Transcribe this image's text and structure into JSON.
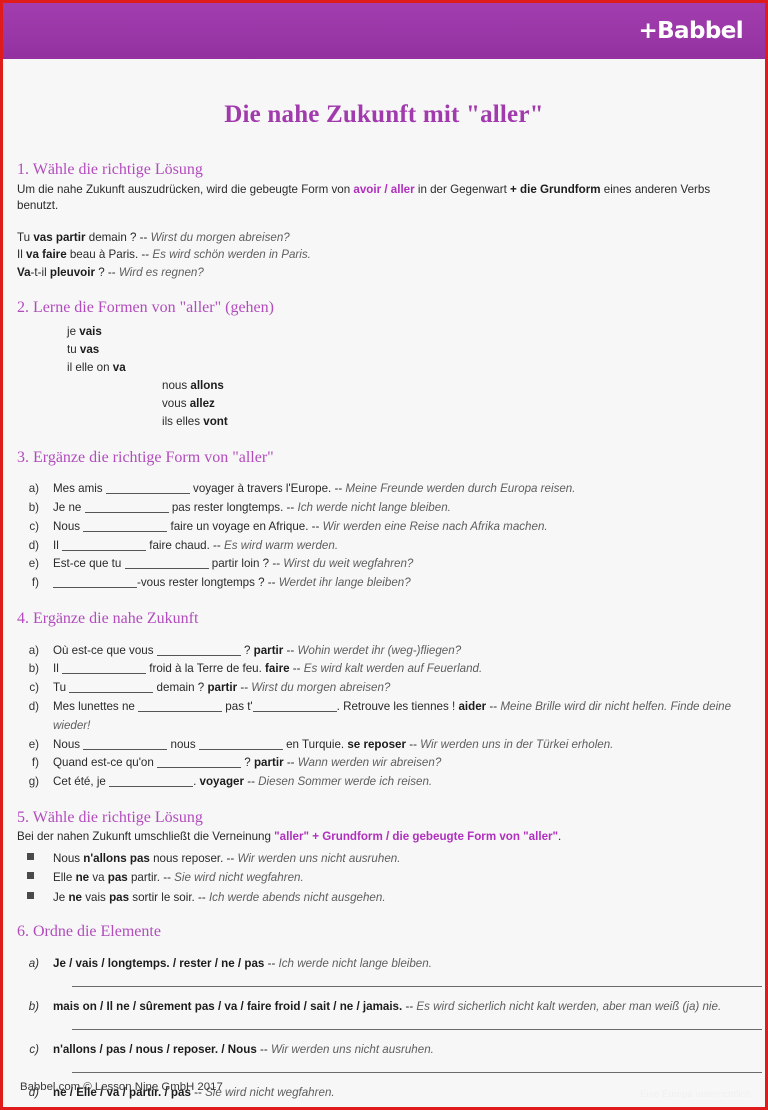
{
  "header": {
    "logo_text": "+Babbel",
    "bar_color": "#9a37a7"
  },
  "document": {
    "title": "Die nahe Zukunft mit \"aller\"",
    "title_color": "#a13aad",
    "accent_color": "#b12fbe"
  },
  "section1": {
    "heading": "1. Wähle die richtige Lösung",
    "intro_part1": "Um die nahe Zukunft auszudrücken, wird die gebeugte Form von ",
    "intro_option": "avoir / aller",
    "intro_part2": " in der Gegenwart ",
    "intro_bold": "+ die Grundform",
    "intro_part3": " eines anderen Verbs benutzt.",
    "examples": [
      {
        "fr_pre": "Tu ",
        "fr_bold": "vas partir",
        "fr_post": " demain ? -- ",
        "de": "Wirst du morgen abreisen?"
      },
      {
        "fr_pre": "Il ",
        "fr_bold": "va faire",
        "fr_post": " beau à Paris. -- ",
        "de": "Es wird schön werden in Paris."
      },
      {
        "fr_pre": "",
        "fr_bold": "Va",
        "fr_post": "-t-il ",
        "fr_bold2": "pleuvoir",
        "fr_post2": " ? -- ",
        "de": "Wird es regnen?"
      }
    ]
  },
  "section2": {
    "heading": "2. Lerne die Formen von \"aller\" (gehen)",
    "singular": [
      {
        "pronoun": "je ",
        "form": "vais"
      },
      {
        "pronoun": "tu ",
        "form": "vas"
      },
      {
        "pronoun": "il elle on ",
        "form": "va"
      }
    ],
    "plural": [
      {
        "pronoun": "nous ",
        "form": "allons"
      },
      {
        "pronoun": "vous ",
        "form": "allez"
      },
      {
        "pronoun": "ils elles ",
        "form": "vont"
      }
    ]
  },
  "section3": {
    "heading": "3. Ergänze die richtige Form von \"aller\"",
    "items": [
      {
        "letter": "a)",
        "pre": "Mes amis ",
        "post": " voyager à travers l'Europe. -- ",
        "de": "Meine Freunde werden durch Europa reisen."
      },
      {
        "letter": "b)",
        "pre": "Je ne ",
        "post": " pas rester longtemps. -- ",
        "de": "Ich werde nicht lange bleiben."
      },
      {
        "letter": "c)",
        "pre": "Nous ",
        "post": " faire un voyage en Afrique. -- ",
        "de": "Wir werden eine Reise nach Afrika machen."
      },
      {
        "letter": "d)",
        "pre": "Il ",
        "post": " faire chaud. -- ",
        "de": "Es wird warm werden."
      },
      {
        "letter": "e)",
        "pre": "Est-ce que tu ",
        "post": " partir loin ? -- ",
        "de": "Wirst du weit wegfahren?"
      },
      {
        "letter": "f)",
        "pre": "",
        "post": "-vous rester longtemps ? -- ",
        "de": "Werdet ihr lange bleiben?"
      }
    ]
  },
  "section4": {
    "heading": "4. Ergänze die nahe Zukunft",
    "items": [
      {
        "letter": "a)",
        "pre": "Où est-ce que vous ",
        "post": " ? ",
        "verb": "partir",
        "tail": " -- ",
        "de": "Wohin werdet ihr (weg-)fliegen?"
      },
      {
        "letter": "b)",
        "pre": "Il ",
        "post": " froid à la Terre de feu. ",
        "verb": "faire",
        "tail": " -- ",
        "de": "Es wird kalt werden auf Feuerland."
      },
      {
        "letter": "c)",
        "pre": "Tu ",
        "post": " demain ? ",
        "verb": "partir",
        "tail": " -- ",
        "de": "Wirst du morgen abreisen?"
      },
      {
        "letter": "d)",
        "pre": "Mes lunettes ne ",
        "mid": " pas t'",
        "post": ". Retrouve les tiennes ! ",
        "verb": "aider",
        "tail": " -- ",
        "de": "Meine Brille wird dir nicht helfen. Finde deine wieder!",
        "two_blanks": true
      },
      {
        "letter": "e)",
        "pre": "Nous ",
        "mid": " nous ",
        "post": " en Turquie. ",
        "verb": "se reposer",
        "tail": " -- ",
        "de": "Wir werden uns in der Türkei erholen.",
        "two_blanks": true
      },
      {
        "letter": "f)",
        "pre": "Quand est-ce qu'on ",
        "post": " ? ",
        "verb": "partir",
        "tail": " -- ",
        "de": "Wann werden wir abreisen?"
      },
      {
        "letter": "g)",
        "pre": "Cet été, je ",
        "post": ". ",
        "verb": "voyager",
        "tail": " -- ",
        "de": "Diesen Sommer werde ich reisen."
      }
    ]
  },
  "section5": {
    "heading": "5. Wähle die richtige Lösung",
    "intro_pre": "Bei der nahen Zukunft umschließt die Verneinung ",
    "intro_option": "\"aller\" + Grundform / die gebeugte Form von \"aller\"",
    "intro_post": ".",
    "items": [
      {
        "pre": "Nous ",
        "b1": "n'allons",
        "mid": " ",
        "b2": "pas",
        "post": " nous reposer. -- ",
        "de": "Wir werden uns nicht ausruhen."
      },
      {
        "pre": "Elle ",
        "b1": "ne",
        "mid": " va ",
        "b2": "pas",
        "post": " partir. -- ",
        "de": "Sie wird nicht wegfahren."
      },
      {
        "pre": "Je ",
        "b1": "ne",
        "mid": " vais ",
        "b2": "pas",
        "post": " sortir le soir. -- ",
        "de": "Ich werde abends nicht ausgehen."
      }
    ]
  },
  "section6": {
    "heading": "6. Ordne die Elemente",
    "items": [
      {
        "letter": "a)",
        "elements": "Je / vais / longtemps. / rester / ne / pas",
        "sep": "  -- ",
        "de": "Ich werde nicht lange bleiben."
      },
      {
        "letter": "b)",
        "elements": "mais on / Il ne / sûrement pas / va / faire froid / sait / ne / jamais.",
        "sep": " -- ",
        "de": "Es wird sicherlich nicht kalt werden, aber man weiß (ja) nie."
      },
      {
        "letter": "c)",
        "elements": "n'allons / pas / nous / reposer. / Nous",
        "sep": " -- ",
        "de": "Wir werden uns nicht ausruhen."
      },
      {
        "letter": "d)",
        "elements": "ne / Elle / va / partir. / pas",
        "sep": " -- ",
        "de": "Sie wird nicht wegfahren."
      }
    ]
  },
  "footer": {
    "copyright": "Babbel.com © Lesson Nine GmbH 2017",
    "watermark": "Eine Europa unterrichtlich"
  }
}
